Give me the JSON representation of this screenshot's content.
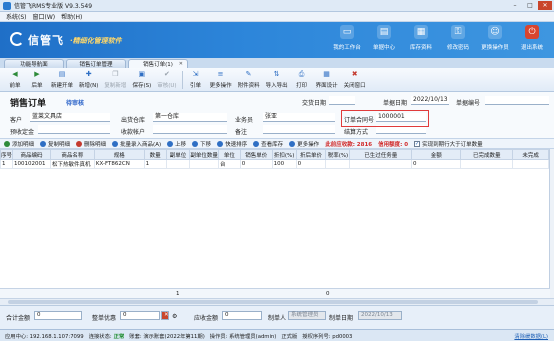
{
  "window": {
    "title": "信管飞RMS专业版 V9.3.549"
  },
  "menu": [
    "系统(S)",
    "窗口(W)",
    "帮助(H)"
  ],
  "banner": {
    "brand": "信管飞",
    "tagline": "·精细化管理软件",
    "nav": [
      {
        "label": "我的工作台",
        "icon": "desktop-icon"
      },
      {
        "label": "单据中心",
        "icon": "documents-icon"
      },
      {
        "label": "库存资料",
        "icon": "inventory-icon"
      },
      {
        "label": "修改密码",
        "icon": "key-icon"
      },
      {
        "label": "更换操作员",
        "icon": "user-switch-icon"
      },
      {
        "label": "退出系统",
        "icon": "power-icon"
      }
    ]
  },
  "tabs": [
    {
      "label": "功能导航面"
    },
    {
      "label": "销售订单管理"
    },
    {
      "label": "销售订单(1)"
    }
  ],
  "toolbar": [
    {
      "label": "前单",
      "icon": "arrow-left-icon",
      "color": "#2e8b3a"
    },
    {
      "label": "后单",
      "icon": "arrow-right-icon",
      "color": "#2e8b3a"
    },
    {
      "label": "新建开单",
      "icon": "new-doc-icon",
      "color": "#2f6fc4"
    },
    {
      "label": "新增(N)",
      "icon": "add-icon",
      "color": "#2f6fc4"
    },
    {
      "label": "复制新增",
      "icon": "copy-icon",
      "color": "#9aa3ad",
      "disabled": true
    },
    {
      "label": "保存(S)",
      "icon": "save-icon",
      "color": "#2f6fc4"
    },
    {
      "label": "审核(U)",
      "icon": "approve-icon",
      "color": "#9aa3ad",
      "disabled": true
    },
    {
      "label": "引单",
      "icon": "import-icon",
      "color": "#2f6fc4"
    },
    {
      "label": "更多操作",
      "icon": "more-icon",
      "color": "#2f6fc4"
    },
    {
      "label": "附件资料",
      "icon": "attachment-icon",
      "color": "#2f6fc4"
    },
    {
      "label": "导入导出",
      "icon": "import-export-icon",
      "color": "#2f6fc4"
    },
    {
      "label": "打印",
      "icon": "print-icon",
      "color": "#2f6fc4"
    },
    {
      "label": "界面设计",
      "icon": "layout-icon",
      "color": "#2f6fc4"
    },
    {
      "label": "关闭窗口",
      "icon": "close-window-icon",
      "color": "#c43a2f"
    }
  ],
  "form": {
    "title": "销售订单",
    "status": "待审核",
    "transaction_date_label": "交货日期",
    "doc_date_label": "单据日期",
    "doc_date_value": "2022/10/13",
    "doc_no_label": "单据编号",
    "customer_label": "客户",
    "customer_value": "蓝莱文具店",
    "warehouse_label": "出货仓库",
    "warehouse_value": "第一仓库",
    "salesperson_label": "业务员",
    "salesperson_value": "张亚",
    "contract_label": "订单合同号",
    "contract_value": "1000001",
    "deposit_label": "预收定金",
    "account_label": "收款帐户",
    "remark_label": "备注",
    "settlement_label": "结算方式"
  },
  "subbar": [
    {
      "label": "添加明细",
      "icon": "add-row-icon",
      "color": "#2e8b3a"
    },
    {
      "label": "复制明细",
      "icon": "copy-row-icon",
      "color": "#2f6fc4"
    },
    {
      "label": "删除明细",
      "icon": "delete-row-icon",
      "color": "#c43a2f"
    },
    {
      "label": "批量录入商品(A)",
      "icon": "batch-icon",
      "color": "#2f6fc4"
    },
    {
      "label": "上移",
      "icon": "move-up-icon",
      "color": "#2f6fc4"
    },
    {
      "label": "下移",
      "icon": "move-down-icon",
      "color": "#2f6fc4"
    },
    {
      "label": "快速排序",
      "icon": "sort-icon",
      "color": "#2f6fc4"
    },
    {
      "label": "查看库存",
      "icon": "stock-icon",
      "color": "#2f6fc4"
    },
    {
      "label": "更多操作",
      "icon": "more-icon",
      "color": "#2f6fc4"
    }
  ],
  "alerts": {
    "last_balance": "此前应收款: 2816",
    "credit_limit": "信用额度: 0",
    "auto_check_label": "实现到期行大于订单数量"
  },
  "grid": {
    "columns": [
      "序号",
      "商品编码",
      "商品名称",
      "规格",
      "数量",
      "副单位",
      "副单位数量",
      "单位",
      "销售单价",
      "折扣(%)",
      "折后单价",
      "税率(%)",
      "已生过任务量",
      "金额",
      "已完成数量",
      "未完成"
    ],
    "rows": [
      [
        "1",
        "100102001",
        "松下热敏件真机",
        "KX-FT862CN",
        "1",
        "",
        "",
        "台",
        "0",
        "100",
        "0",
        "",
        "",
        "0",
        "",
        ""
      ]
    ],
    "footer_qty": "1",
    "footer_amount": "0"
  },
  "footer": {
    "total_label": "合计金额",
    "total_value": "0",
    "discount_label": "整单优惠",
    "discount_value": "0",
    "receivable_label": "应收金额",
    "receivable_value": "0",
    "maker_label": "制单人",
    "maker_value": "系统管理员",
    "make_date_label": "制单日期",
    "make_date_value": "2022/10/13"
  },
  "status": {
    "app_center": "应用中心: 192.168.1.107:7099",
    "connection_label": "连接状态:",
    "connection_value": "正常",
    "account_set": "账套: 演示账套(2022年第11期)",
    "operator": "操作员: 系统管理员(admin)",
    "edition": "正式版",
    "license": "授权序列号: pd0003",
    "clear_cache": "清除缓数据(L)"
  }
}
